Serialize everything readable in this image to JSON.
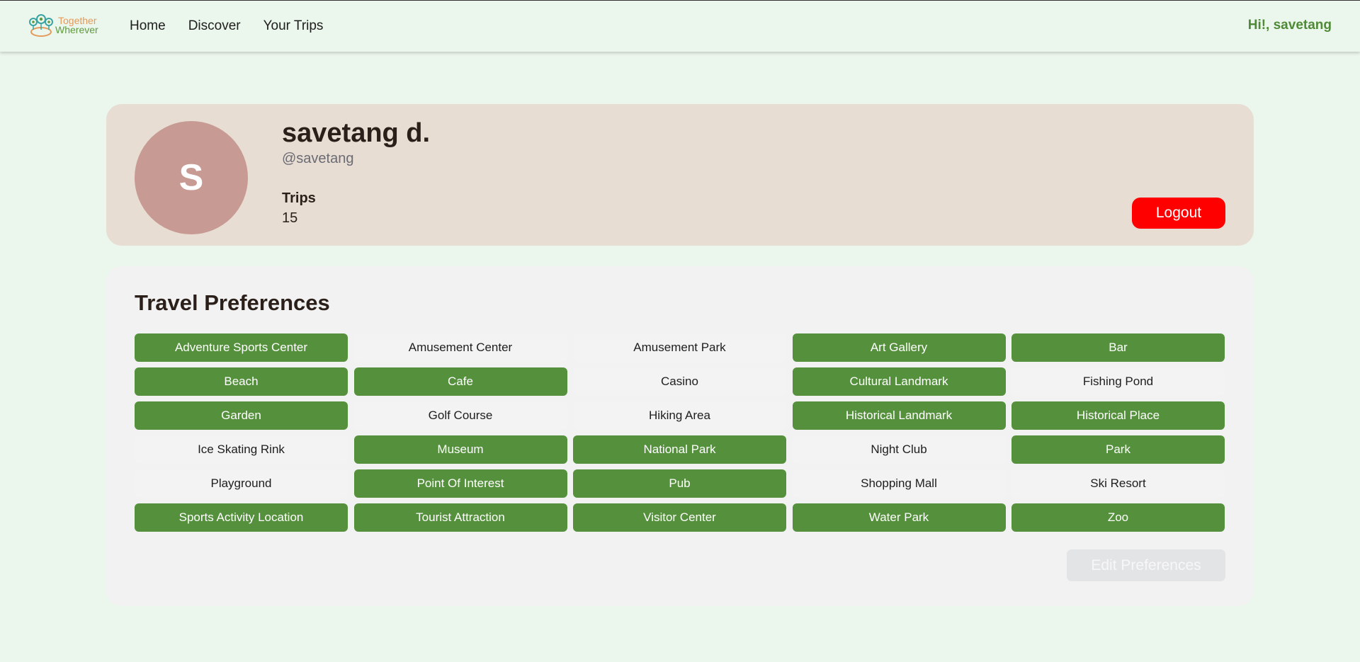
{
  "app": {
    "logo_line1": "Together",
    "logo_line2": "Wherever"
  },
  "nav": {
    "items": [
      "Home",
      "Discover",
      "Your Trips"
    ],
    "greeting": "Hi!, savetang"
  },
  "profile": {
    "avatar_initial": "S",
    "name": "savetang d.",
    "handle": "@savetang",
    "trips_label": "Trips",
    "trips_count": "15",
    "logout_label": "Logout"
  },
  "preferences": {
    "title": "Travel Preferences",
    "edit_label": "Edit Preferences",
    "items": [
      {
        "label": "Adventure Sports Center",
        "selected": true
      },
      {
        "label": "Amusement Center",
        "selected": false
      },
      {
        "label": "Amusement Park",
        "selected": false
      },
      {
        "label": "Art Gallery",
        "selected": true
      },
      {
        "label": "Bar",
        "selected": true
      },
      {
        "label": "Beach",
        "selected": true
      },
      {
        "label": "Cafe",
        "selected": true
      },
      {
        "label": "Casino",
        "selected": false
      },
      {
        "label": "Cultural Landmark",
        "selected": true
      },
      {
        "label": "Fishing Pond",
        "selected": false
      },
      {
        "label": "Garden",
        "selected": true
      },
      {
        "label": "Golf Course",
        "selected": false
      },
      {
        "label": "Hiking Area",
        "selected": false
      },
      {
        "label": "Historical Landmark",
        "selected": true
      },
      {
        "label": "Historical Place",
        "selected": true
      },
      {
        "label": "Ice Skating Rink",
        "selected": false
      },
      {
        "label": "Museum",
        "selected": true
      },
      {
        "label": "National Park",
        "selected": true
      },
      {
        "label": "Night Club",
        "selected": false
      },
      {
        "label": "Park",
        "selected": true
      },
      {
        "label": "Playground",
        "selected": false
      },
      {
        "label": "Point Of Interest",
        "selected": true
      },
      {
        "label": "Pub",
        "selected": true
      },
      {
        "label": "Shopping Mall",
        "selected": false
      },
      {
        "label": "Ski Resort",
        "selected": false
      },
      {
        "label": "Sports Activity Location",
        "selected": true
      },
      {
        "label": "Tourist Attraction",
        "selected": true
      },
      {
        "label": "Visitor Center",
        "selected": true
      },
      {
        "label": "Water Park",
        "selected": true
      },
      {
        "label": "Zoo",
        "selected": true
      }
    ]
  },
  "colors": {
    "page_bg": "#ebf6ec",
    "accent_green": "#55913d",
    "greeting_green": "#4f8a36",
    "logout_red": "#ff0000",
    "profile_card_bg": "#e7ddd3",
    "avatar_bg": "#c79a93"
  }
}
